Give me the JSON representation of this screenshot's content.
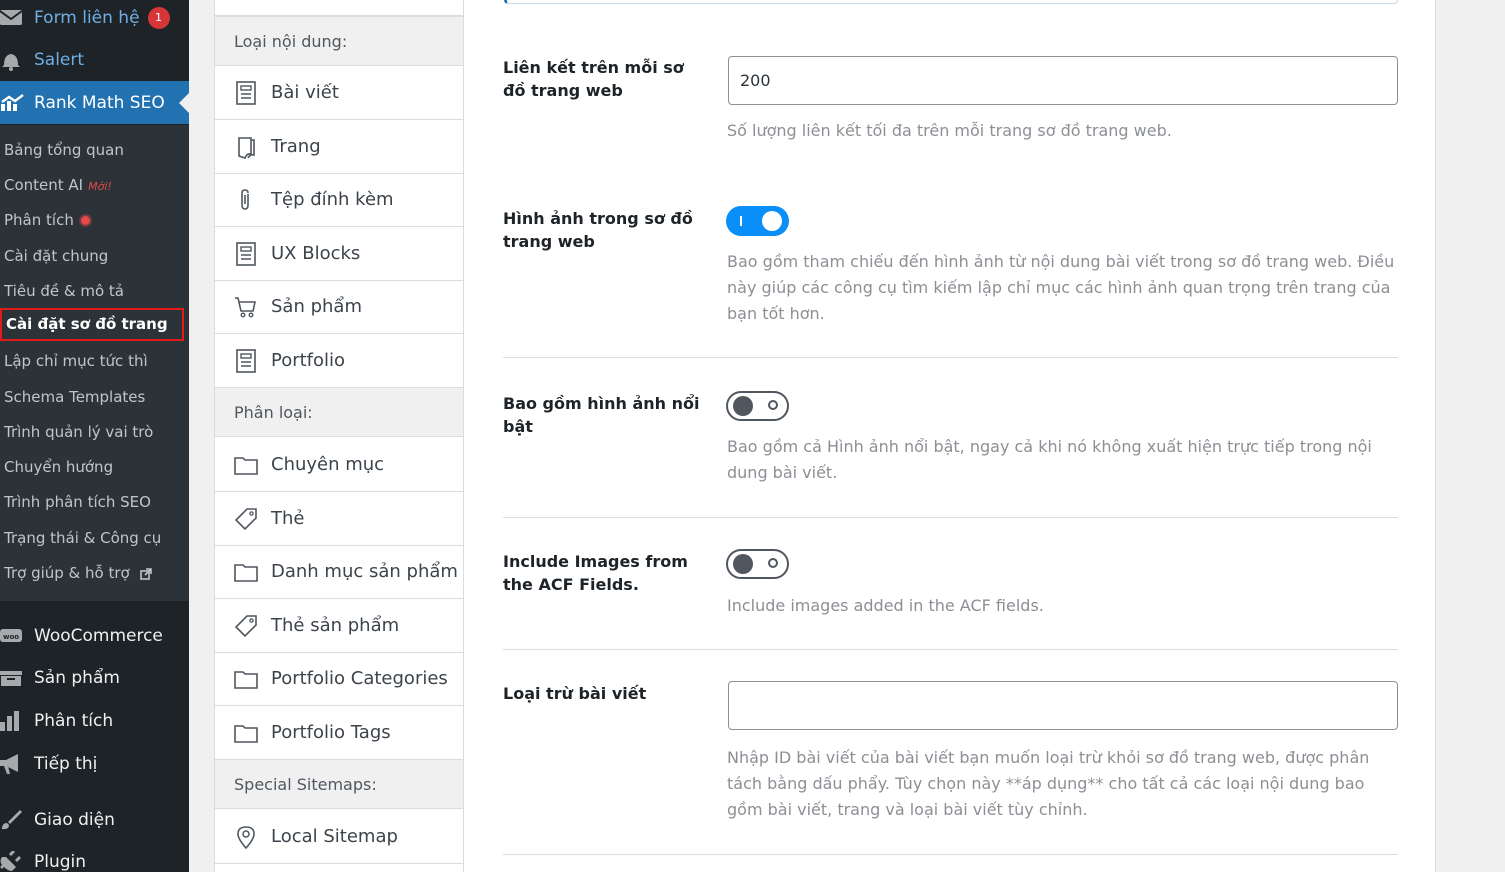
{
  "sidebar": {
    "top_items": [
      {
        "label": "Form liên hệ",
        "icon": "mail-icon",
        "badge": "1"
      },
      {
        "label": "Salert",
        "icon": "bell-icon"
      },
      {
        "label": "Rank Math SEO",
        "icon": "rank-math-icon"
      }
    ],
    "sub_items": [
      {
        "label": "Bảng tổng quan"
      },
      {
        "label": "Content AI",
        "tag": "Mới!"
      },
      {
        "label": "Phân tích"
      },
      {
        "label": "Cài đặt chung"
      },
      {
        "label": "Tiêu đề & mô tả"
      },
      {
        "label": "Cài đặt sơ đồ trang"
      },
      {
        "label": "Lập chỉ mục tức thì"
      },
      {
        "label": "Schema Templates"
      },
      {
        "label": "Trình quản lý vai trò"
      },
      {
        "label": "Chuyển hướng"
      },
      {
        "label": "Trình phân tích SEO"
      },
      {
        "label": "Trạng thái & Công cụ"
      },
      {
        "label": "Trợ giúp & hỗ trợ"
      }
    ],
    "bottom_items": [
      {
        "label": "WooCommerce",
        "icon": "woo-icon"
      },
      {
        "label": "Sản phẩm",
        "icon": "archive-icon"
      },
      {
        "label": "Phân tích",
        "icon": "bar-chart-icon"
      },
      {
        "label": "Tiếp thị",
        "icon": "megaphone-icon"
      },
      {
        "label": "Giao diện",
        "icon": "brush-icon"
      },
      {
        "label": "Plugin",
        "icon": "plug-icon"
      }
    ],
    "colors": {
      "bg": "#1d2327",
      "submenu_bg": "#2c3338",
      "accent": "#2271b1",
      "highlight": "#e21a1a"
    }
  },
  "nav": {
    "head_post_types": "Loại nội dung:",
    "post_types": [
      {
        "label": "Bài viết",
        "icon": "document-icon"
      },
      {
        "label": "Trang",
        "icon": "page-icon"
      },
      {
        "label": "Tệp đính kèm",
        "icon": "paperclip-icon"
      },
      {
        "label": "UX Blocks",
        "icon": "document-icon"
      },
      {
        "label": "Sản phẩm",
        "icon": "cart-icon"
      },
      {
        "label": "Portfolio",
        "icon": "document-icon"
      }
    ],
    "head_taxonomies": "Phân loại:",
    "taxonomies": [
      {
        "label": "Chuyên mục",
        "icon": "folder-icon"
      },
      {
        "label": "Thẻ",
        "icon": "tag-icon"
      },
      {
        "label": "Danh mục sản phẩm",
        "icon": "folder-icon"
      },
      {
        "label": "Thẻ sản phẩm",
        "icon": "tag-icon"
      },
      {
        "label": "Portfolio Categories",
        "icon": "folder-icon"
      },
      {
        "label": "Portfolio Tags",
        "icon": "folder-icon"
      }
    ],
    "head_special": "Special Sitemaps:",
    "special": [
      {
        "label": "Local Sitemap",
        "icon": "location-pin-icon"
      }
    ]
  },
  "settings": {
    "links_per_sitemap": {
      "label": "Liên kết trên mỗi sơ đồ trang web",
      "value": "200",
      "desc": "Số lượng liên kết tối đa trên mỗi trang sơ đồ trang web."
    },
    "images_in_sitemap": {
      "label": "Hình ảnh trong sơ đồ trang web",
      "enabled": true,
      "desc": "Bao gồm tham chiếu đến hình ảnh từ nội dung bài viết trong sơ đồ trang web. Điều này giúp các công cụ tìm kiếm lập chỉ mục các hình ảnh quan trọng trên trang của bạn tốt hơn."
    },
    "featured_image": {
      "label": "Bao gồm hình ảnh nổi bật",
      "enabled": false,
      "desc": "Bao gồm cả Hình ảnh nổi bật, ngay cả khi nó không xuất hiện trực tiếp trong nội dung bài viết."
    },
    "acf_images": {
      "label": "Include Images from the ACF Fields.",
      "enabled": false,
      "desc": "Include images added in the ACF fields."
    },
    "exclude_posts": {
      "label": "Loại trừ bài viết",
      "value": "",
      "desc": "Nhập ID bài viết của bài viết bạn muốn loại trừ khỏi sơ đồ trang web, được phân tách bằng dấu phẩy. Tùy chọn này **áp dụng** cho tất cả các loại nội dung bao gồm bài viết, trang và loại bài viết tùy chỉnh."
    },
    "colors": {
      "toggle_on": "#0a8ef8",
      "toggle_off": "#50575e",
      "desc_text": "#8c8f94"
    }
  }
}
